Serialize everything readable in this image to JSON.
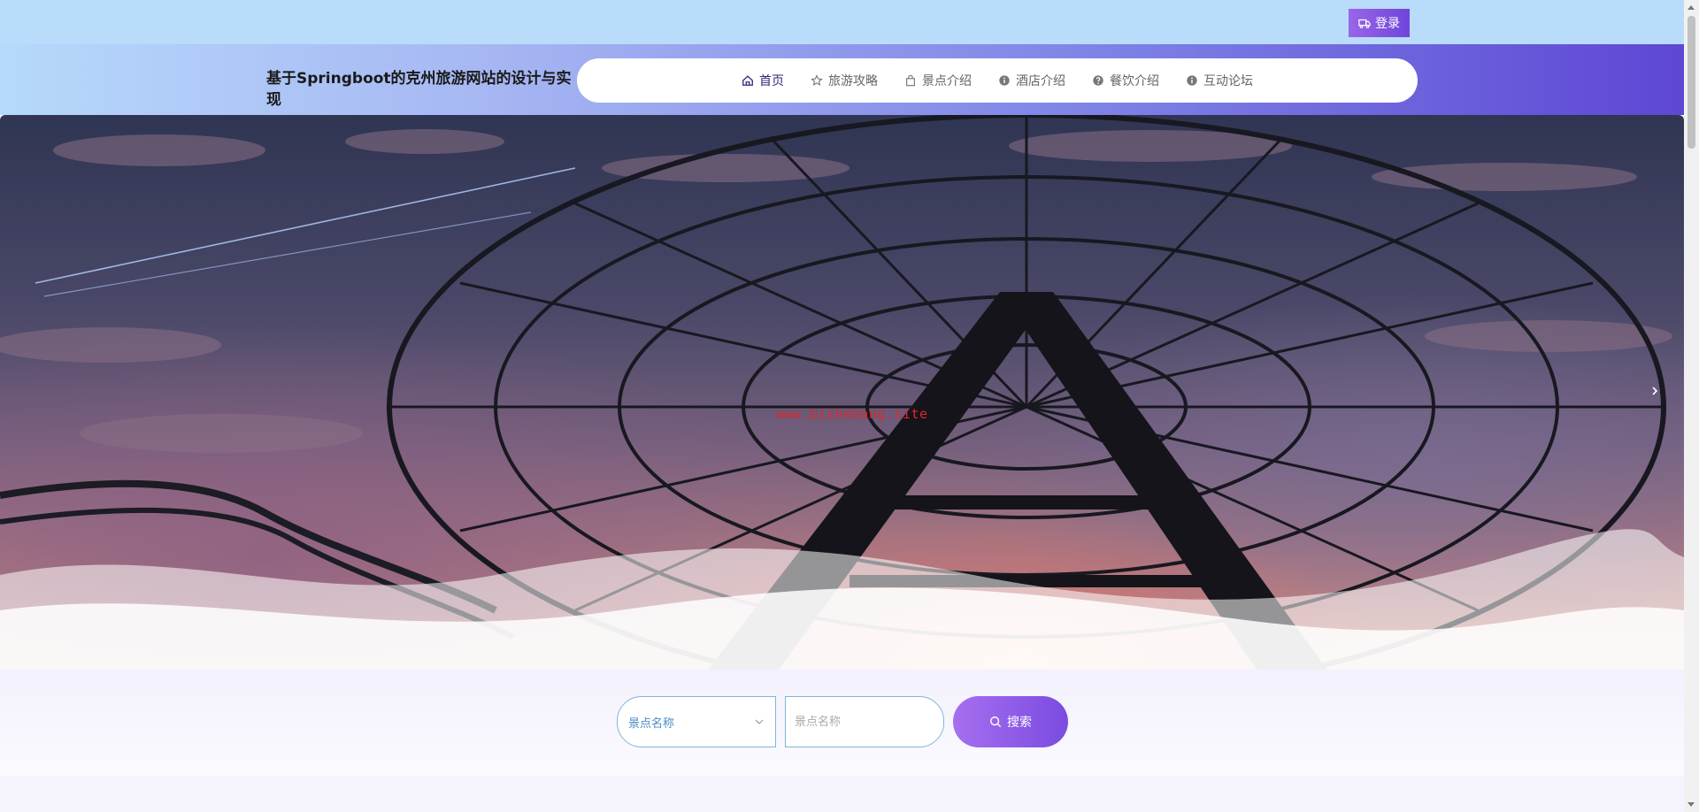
{
  "topbar": {
    "login_label": "登录",
    "login_icon": "truck-icon"
  },
  "header": {
    "title": "基于Springboot的克州旅游网站的设计与实现"
  },
  "nav": {
    "items": [
      {
        "label": "首页",
        "icon": "home-icon",
        "active": true
      },
      {
        "label": "旅游攻略",
        "icon": "star-icon",
        "active": false
      },
      {
        "label": "景点介绍",
        "icon": "bag-icon",
        "active": false
      },
      {
        "label": "酒店介绍",
        "icon": "info-circle-icon",
        "active": false
      },
      {
        "label": "餐饮介绍",
        "icon": "question-circle-icon",
        "active": false
      },
      {
        "label": "互动论坛",
        "icon": "info-circle-icon",
        "active": false
      }
    ]
  },
  "banner": {
    "watermark": "www.bishebang.site",
    "next_icon": "chevron-right-icon"
  },
  "search": {
    "select_value": "景点名称",
    "input_placeholder": "景点名称",
    "button_label": "搜索"
  },
  "colors": {
    "accent": "#7b4be0",
    "topbar_bg": "#b8dcf9",
    "header_end": "#5d47d4",
    "watermark": "#e0262a"
  }
}
